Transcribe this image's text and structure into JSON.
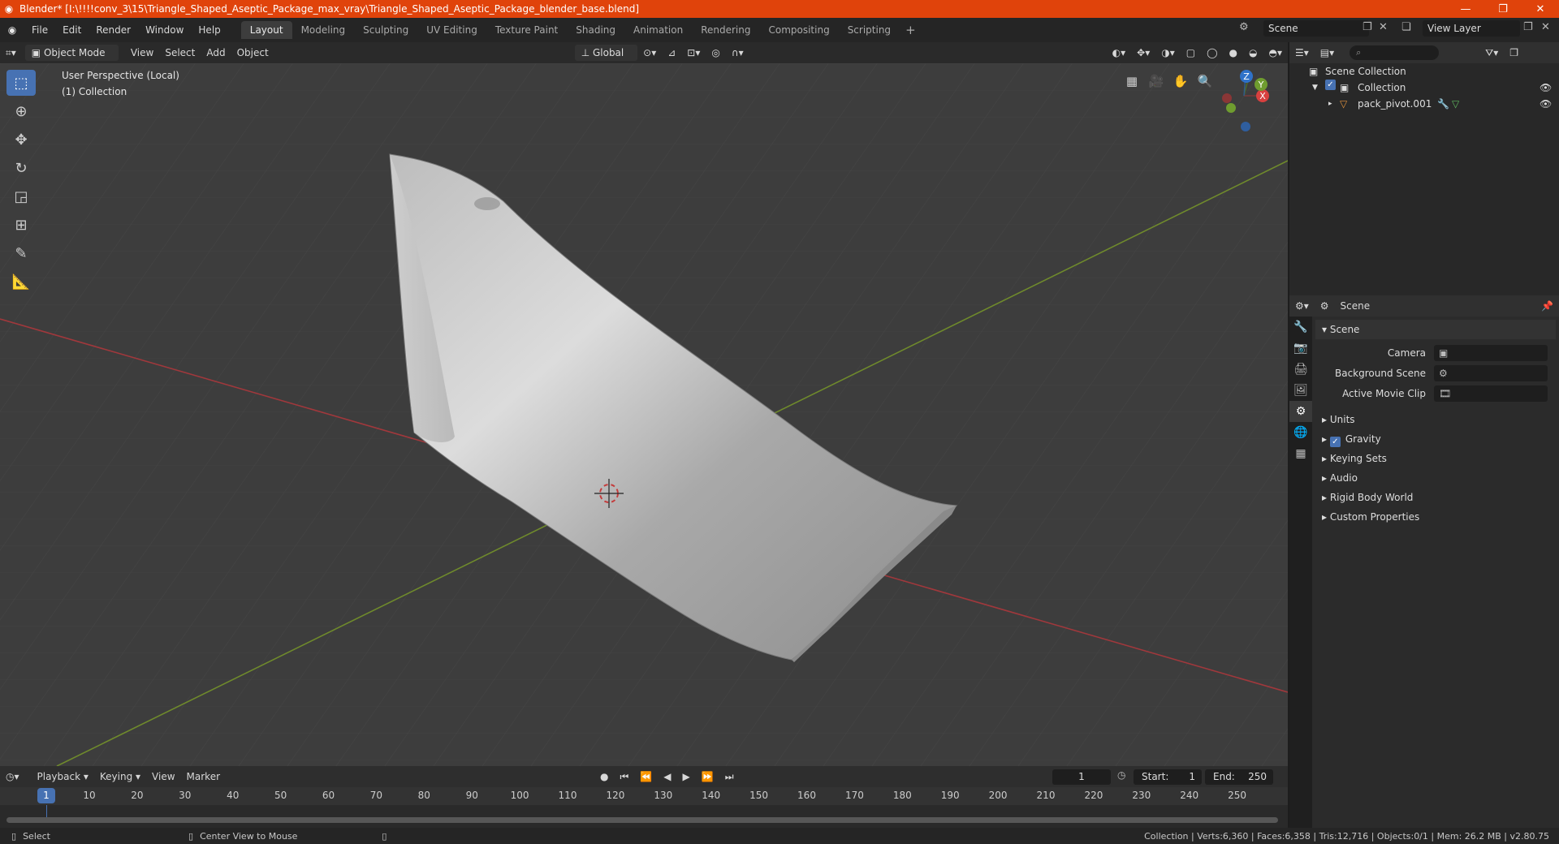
{
  "window": {
    "title": "Blender* [I:\\!!!!conv_3\\15\\Triangle_Shaped_Aseptic_Package_max_vray\\Triangle_Shaped_Aseptic_Package_blender_base.blend]",
    "minimize": "—",
    "maximize": "❐",
    "close": "✕",
    "accent": "#e0430b"
  },
  "menu": [
    "File",
    "Edit",
    "Render",
    "Window",
    "Help"
  ],
  "workspaces": [
    "Layout",
    "Modeling",
    "Sculpting",
    "UV Editing",
    "Texture Paint",
    "Shading",
    "Animation",
    "Rendering",
    "Compositing",
    "Scripting"
  ],
  "workspace_add": "+",
  "scene_selector": {
    "value": "Scene"
  },
  "view_layer": {
    "value": "View Layer"
  },
  "viewport_header": {
    "mode": "Object Mode",
    "menus": [
      "View",
      "Select",
      "Add",
      "Object"
    ],
    "orientation": "Global"
  },
  "viewport": {
    "perspective": "User Perspective (Local)",
    "collection": "(1) Collection",
    "gizmo": {
      "x": "X",
      "y": "Y",
      "z": "Z"
    },
    "axis_colors": {
      "x": "#a0383c",
      "y": "#6f8a2c"
    },
    "background": "#3d3d3d"
  },
  "outliner": {
    "search_placeholder": "⌕",
    "rows": [
      {
        "label": "Scene Collection"
      },
      {
        "label": "Collection"
      },
      {
        "label": "pack_pivot.001"
      }
    ]
  },
  "properties": {
    "context": "Scene",
    "panel": "Scene",
    "fields": [
      {
        "label": "Camera"
      },
      {
        "label": "Background Scene"
      },
      {
        "label": "Active Movie Clip"
      }
    ],
    "subpanels": [
      "Units",
      "Gravity",
      "Keying Sets",
      "Audio",
      "Rigid Body World",
      "Custom Properties"
    ]
  },
  "timeline": {
    "menus": [
      "Playback",
      "Keying",
      "View",
      "Marker"
    ],
    "current_frame": "1",
    "start_label": "Start:",
    "start": "1",
    "end_label": "End:",
    "end": "250",
    "ticks": [
      "10",
      "20",
      "30",
      "40",
      "50",
      "60",
      "70",
      "80",
      "90",
      "100",
      "110",
      "120",
      "130",
      "140",
      "150",
      "160",
      "170",
      "180",
      "190",
      "200",
      "210",
      "220",
      "230",
      "240",
      "250"
    ]
  },
  "status": {
    "left": "Select",
    "middle": "Center View to Mouse",
    "right": "Collection | Verts:6,360 | Faces:6,358 | Tris:12,716 | Objects:0/1 | Mem: 26.2 MB | v2.80.75"
  }
}
